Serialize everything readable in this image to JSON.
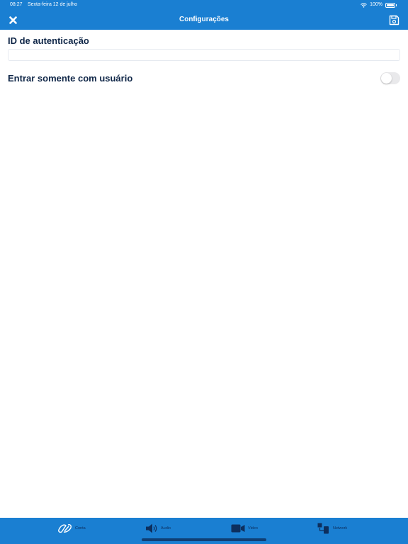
{
  "status_bar": {
    "time": "08:27",
    "date": "Sexta-feira 12 de julho",
    "battery": "100%"
  },
  "nav": {
    "title": "Configurações"
  },
  "auth": {
    "title": "ID de autenticação",
    "value": "",
    "placeholder": ""
  },
  "user_only": {
    "title": "Entrar somente com usuário",
    "enabled": false
  },
  "tabs": [
    {
      "label": "Conta",
      "icon": "account-icon"
    },
    {
      "label": "Audio",
      "icon": "speaker-icon"
    },
    {
      "label": "Video",
      "icon": "camera-icon"
    },
    {
      "label": "Network",
      "icon": "network-icon"
    }
  ],
  "colors": {
    "primary": "#1a7fd2",
    "heading": "#0f2647",
    "tab_icon": "#0d2f5e"
  }
}
